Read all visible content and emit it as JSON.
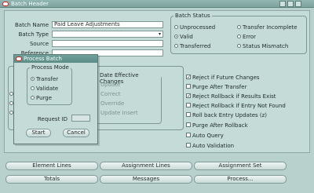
{
  "window": {
    "title": "Batch Header"
  },
  "header": {
    "batch_name_label": "Batch Name",
    "batch_name_value": "Paid Leave Adjustments",
    "batch_type_label": "Batch Type",
    "source_label": "Source",
    "reference_label": "Reference"
  },
  "batch_status": {
    "title": "Batch Status",
    "options": [
      "Unprocessed",
      "Transfer Incomplete",
      "Valid",
      "Error",
      "Transferred",
      "Status Mismatch"
    ],
    "selected": "Valid"
  },
  "overwrite": {
    "group_title": "Date Effective Changes",
    "partial_labels": [
      "Update",
      "Correct",
      "Override",
      "Update Insert"
    ]
  },
  "checkboxes": [
    {
      "label": "Reject if Future Changes",
      "checked": true
    },
    {
      "label": "Purge After Transfer",
      "checked": false
    },
    {
      "label": "Reject Rollback if Results Exist",
      "checked": true
    },
    {
      "label": "Reject Rollback if Entry Not Found",
      "checked": false
    },
    {
      "label": "Roll back Entry Updates (z)",
      "checked": false
    },
    {
      "label": "Purge After Rollback",
      "checked": false
    },
    {
      "label": "Auto Query",
      "checked": false
    },
    {
      "label": "Auto Validation",
      "checked": false
    }
  ],
  "buttons": {
    "element_lines": "Element Lines",
    "assignment_lines": "Assignment Lines",
    "assignment_set": "Assignment Set",
    "totals": "Totals",
    "messages": "Messages",
    "process": "Process..."
  },
  "dialog": {
    "title": "Process Batch",
    "mode_title": "Process Mode",
    "modes": [
      "Transfer",
      "Validate",
      "Purge"
    ],
    "selected_mode": "Transfer",
    "request_id_label": "Request ID",
    "request_id_value": "",
    "start_label": "Start",
    "cancel_label": "Cancel"
  }
}
